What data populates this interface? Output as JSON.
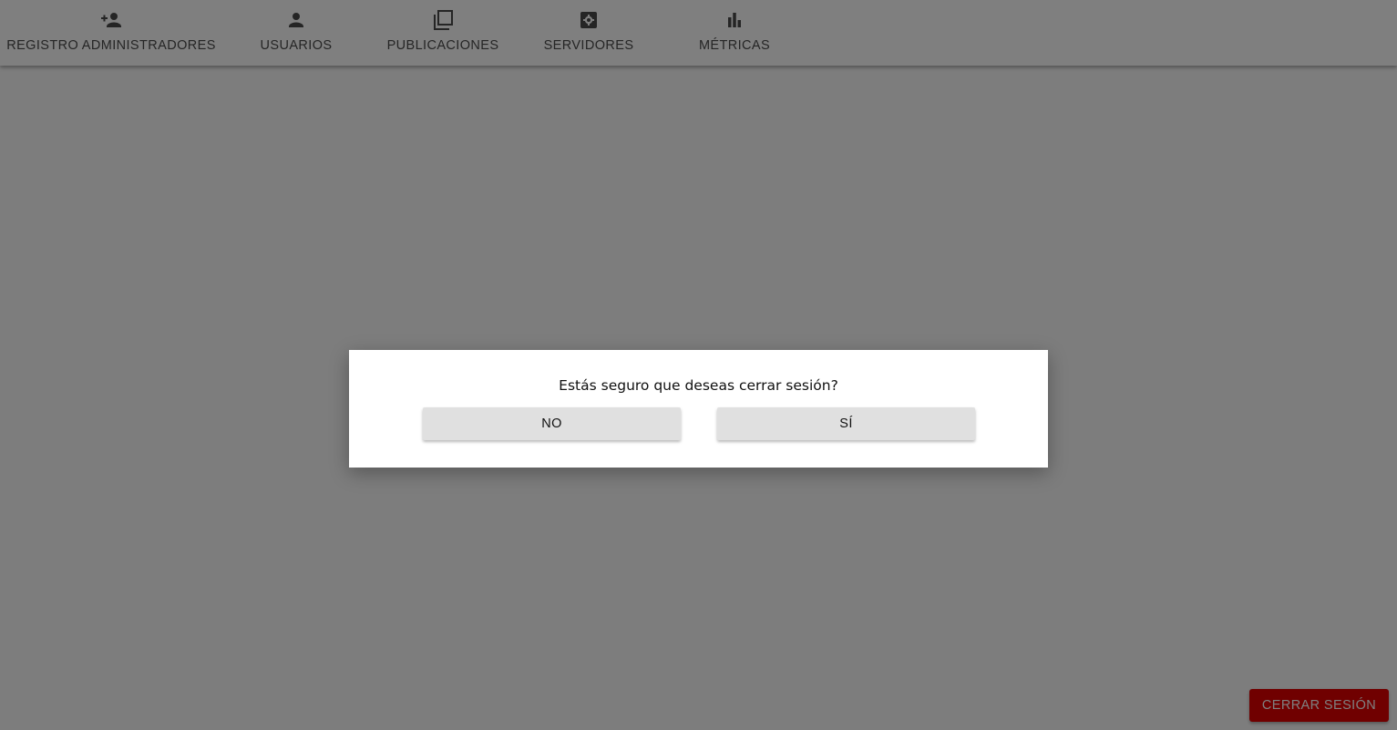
{
  "nav": {
    "tabs": [
      {
        "label": "REGISTRO ADMINISTRADORES",
        "icon": "person-add-icon"
      },
      {
        "label": "USUARIOS",
        "icon": "person-icon"
      },
      {
        "label": "PUBLICACIONES",
        "icon": "library-icon"
      },
      {
        "label": "SERVIDORES",
        "icon": "server-settings-icon"
      },
      {
        "label": "MÉTRICAS",
        "icon": "bar-chart-icon"
      }
    ]
  },
  "logout": {
    "label": "CERRAR SESIÓN"
  },
  "dialog": {
    "message": "Estás seguro que deseas cerrar sesión?",
    "no_label": "NO",
    "yes_label": "SÍ"
  },
  "colors": {
    "logout_red": "#e00000",
    "button_gray": "#e0e0e0",
    "overlay": "rgba(0,0,0,0.5)"
  }
}
